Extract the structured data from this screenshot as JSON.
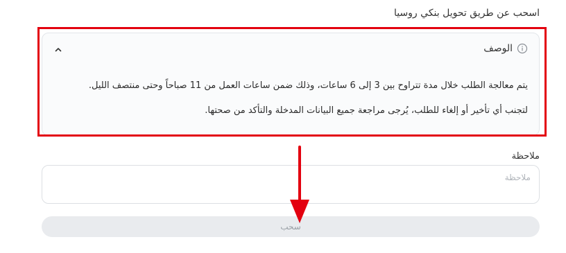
{
  "page": {
    "title": "اسحب عن طريق تحويل بنكي روسيا"
  },
  "description": {
    "title": "الوصف",
    "line1": "يتم معالجة الطلب خلال مدة تتراوح بين 3 إلى 6 ساعات، وذلك ضمن ساعات العمل من 11 صباحاً وحتى منتصف الليل.",
    "line2": "لتجنب أي تأخير أو إلغاء للطلب، يُرجى مراجعة جميع البيانات المدخلة والتأكد من صحتها."
  },
  "note": {
    "label": "ملاحظة",
    "placeholder": "ملاحظة",
    "value": ""
  },
  "withdraw_button": {
    "label": "سحب"
  },
  "colors": {
    "annotation": "#e3000f",
    "card_bg": "#fafbfc",
    "button_bg": "#e9ebee",
    "button_text": "#9aa0a6"
  },
  "icons": {
    "info": "info-icon",
    "chevron": "chevron-up-icon"
  }
}
